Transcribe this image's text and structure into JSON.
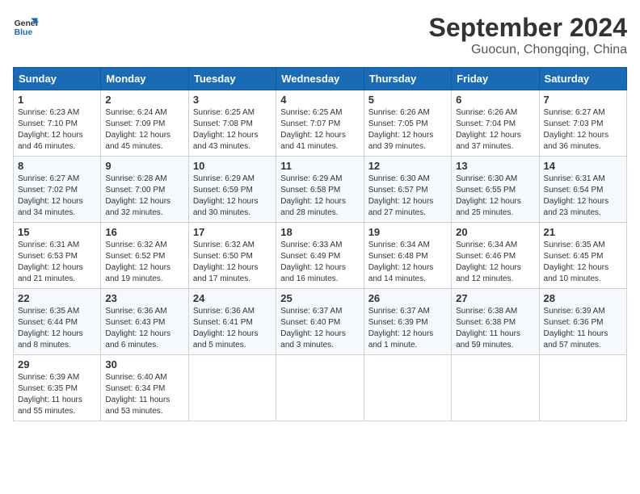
{
  "header": {
    "logo_line1": "General",
    "logo_line2": "Blue",
    "month_title": "September 2024",
    "location": "Guocun, Chongqing, China"
  },
  "days_of_week": [
    "Sunday",
    "Monday",
    "Tuesday",
    "Wednesday",
    "Thursday",
    "Friday",
    "Saturday"
  ],
  "weeks": [
    [
      {
        "day": "1",
        "info": "Sunrise: 6:23 AM\nSunset: 7:10 PM\nDaylight: 12 hours\nand 46 minutes."
      },
      {
        "day": "2",
        "info": "Sunrise: 6:24 AM\nSunset: 7:09 PM\nDaylight: 12 hours\nand 45 minutes."
      },
      {
        "day": "3",
        "info": "Sunrise: 6:25 AM\nSunset: 7:08 PM\nDaylight: 12 hours\nand 43 minutes."
      },
      {
        "day": "4",
        "info": "Sunrise: 6:25 AM\nSunset: 7:07 PM\nDaylight: 12 hours\nand 41 minutes."
      },
      {
        "day": "5",
        "info": "Sunrise: 6:26 AM\nSunset: 7:05 PM\nDaylight: 12 hours\nand 39 minutes."
      },
      {
        "day": "6",
        "info": "Sunrise: 6:26 AM\nSunset: 7:04 PM\nDaylight: 12 hours\nand 37 minutes."
      },
      {
        "day": "7",
        "info": "Sunrise: 6:27 AM\nSunset: 7:03 PM\nDaylight: 12 hours\nand 36 minutes."
      }
    ],
    [
      {
        "day": "8",
        "info": "Sunrise: 6:27 AM\nSunset: 7:02 PM\nDaylight: 12 hours\nand 34 minutes."
      },
      {
        "day": "9",
        "info": "Sunrise: 6:28 AM\nSunset: 7:00 PM\nDaylight: 12 hours\nand 32 minutes."
      },
      {
        "day": "10",
        "info": "Sunrise: 6:29 AM\nSunset: 6:59 PM\nDaylight: 12 hours\nand 30 minutes."
      },
      {
        "day": "11",
        "info": "Sunrise: 6:29 AM\nSunset: 6:58 PM\nDaylight: 12 hours\nand 28 minutes."
      },
      {
        "day": "12",
        "info": "Sunrise: 6:30 AM\nSunset: 6:57 PM\nDaylight: 12 hours\nand 27 minutes."
      },
      {
        "day": "13",
        "info": "Sunrise: 6:30 AM\nSunset: 6:55 PM\nDaylight: 12 hours\nand 25 minutes."
      },
      {
        "day": "14",
        "info": "Sunrise: 6:31 AM\nSunset: 6:54 PM\nDaylight: 12 hours\nand 23 minutes."
      }
    ],
    [
      {
        "day": "15",
        "info": "Sunrise: 6:31 AM\nSunset: 6:53 PM\nDaylight: 12 hours\nand 21 minutes."
      },
      {
        "day": "16",
        "info": "Sunrise: 6:32 AM\nSunset: 6:52 PM\nDaylight: 12 hours\nand 19 minutes."
      },
      {
        "day": "17",
        "info": "Sunrise: 6:32 AM\nSunset: 6:50 PM\nDaylight: 12 hours\nand 17 minutes."
      },
      {
        "day": "18",
        "info": "Sunrise: 6:33 AM\nSunset: 6:49 PM\nDaylight: 12 hours\nand 16 minutes."
      },
      {
        "day": "19",
        "info": "Sunrise: 6:34 AM\nSunset: 6:48 PM\nDaylight: 12 hours\nand 14 minutes."
      },
      {
        "day": "20",
        "info": "Sunrise: 6:34 AM\nSunset: 6:46 PM\nDaylight: 12 hours\nand 12 minutes."
      },
      {
        "day": "21",
        "info": "Sunrise: 6:35 AM\nSunset: 6:45 PM\nDaylight: 12 hours\nand 10 minutes."
      }
    ],
    [
      {
        "day": "22",
        "info": "Sunrise: 6:35 AM\nSunset: 6:44 PM\nDaylight: 12 hours\nand 8 minutes."
      },
      {
        "day": "23",
        "info": "Sunrise: 6:36 AM\nSunset: 6:43 PM\nDaylight: 12 hours\nand 6 minutes."
      },
      {
        "day": "24",
        "info": "Sunrise: 6:36 AM\nSunset: 6:41 PM\nDaylight: 12 hours\nand 5 minutes."
      },
      {
        "day": "25",
        "info": "Sunrise: 6:37 AM\nSunset: 6:40 PM\nDaylight: 12 hours\nand 3 minutes."
      },
      {
        "day": "26",
        "info": "Sunrise: 6:37 AM\nSunset: 6:39 PM\nDaylight: 12 hours\nand 1 minute."
      },
      {
        "day": "27",
        "info": "Sunrise: 6:38 AM\nSunset: 6:38 PM\nDaylight: 11 hours\nand 59 minutes."
      },
      {
        "day": "28",
        "info": "Sunrise: 6:39 AM\nSunset: 6:36 PM\nDaylight: 11 hours\nand 57 minutes."
      }
    ],
    [
      {
        "day": "29",
        "info": "Sunrise: 6:39 AM\nSunset: 6:35 PM\nDaylight: 11 hours\nand 55 minutes."
      },
      {
        "day": "30",
        "info": "Sunrise: 6:40 AM\nSunset: 6:34 PM\nDaylight: 11 hours\nand 53 minutes."
      },
      {
        "day": "",
        "info": ""
      },
      {
        "day": "",
        "info": ""
      },
      {
        "day": "",
        "info": ""
      },
      {
        "day": "",
        "info": ""
      },
      {
        "day": "",
        "info": ""
      }
    ]
  ]
}
